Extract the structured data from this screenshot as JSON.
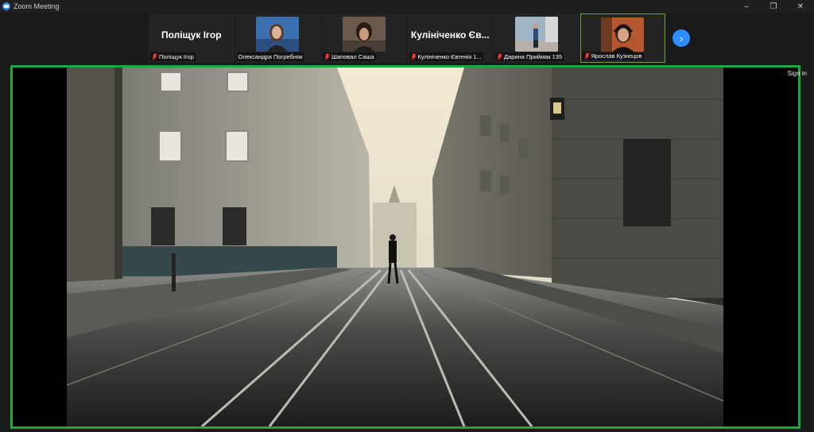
{
  "window": {
    "title": "Zoom Meeting",
    "controls": [
      "–",
      "❐",
      "✕"
    ]
  },
  "participants": [
    {
      "display_name": "Поліщук Ігор",
      "label": "Поліщук Ігор",
      "muted": true,
      "video": false
    },
    {
      "label": "Олександра Погребняк",
      "muted": false,
      "video": true
    },
    {
      "label": "Шаповал Саша",
      "muted": true,
      "video": true
    },
    {
      "display_name": "Кулініченко Єв...",
      "label": "Кулініченко Євгенія 1...",
      "muted": true,
      "video": false
    },
    {
      "label": "Дарина Приймак 135",
      "muted": true,
      "video": true
    },
    {
      "label": "Ярослав Кузнєцов",
      "muted": true,
      "video": true,
      "active_speaker": true
    }
  ],
  "next_arrow": "›",
  "sign_in": "Sign in",
  "colors": {
    "share_border": "#1fa83a",
    "active_speaker": "#6fa63a",
    "muted_icon": "#ff3b30",
    "accent": "#2d8cff"
  },
  "icons": [
    "zoom-app-icon",
    "mic-muted-icon",
    "chevron-right-icon"
  ]
}
